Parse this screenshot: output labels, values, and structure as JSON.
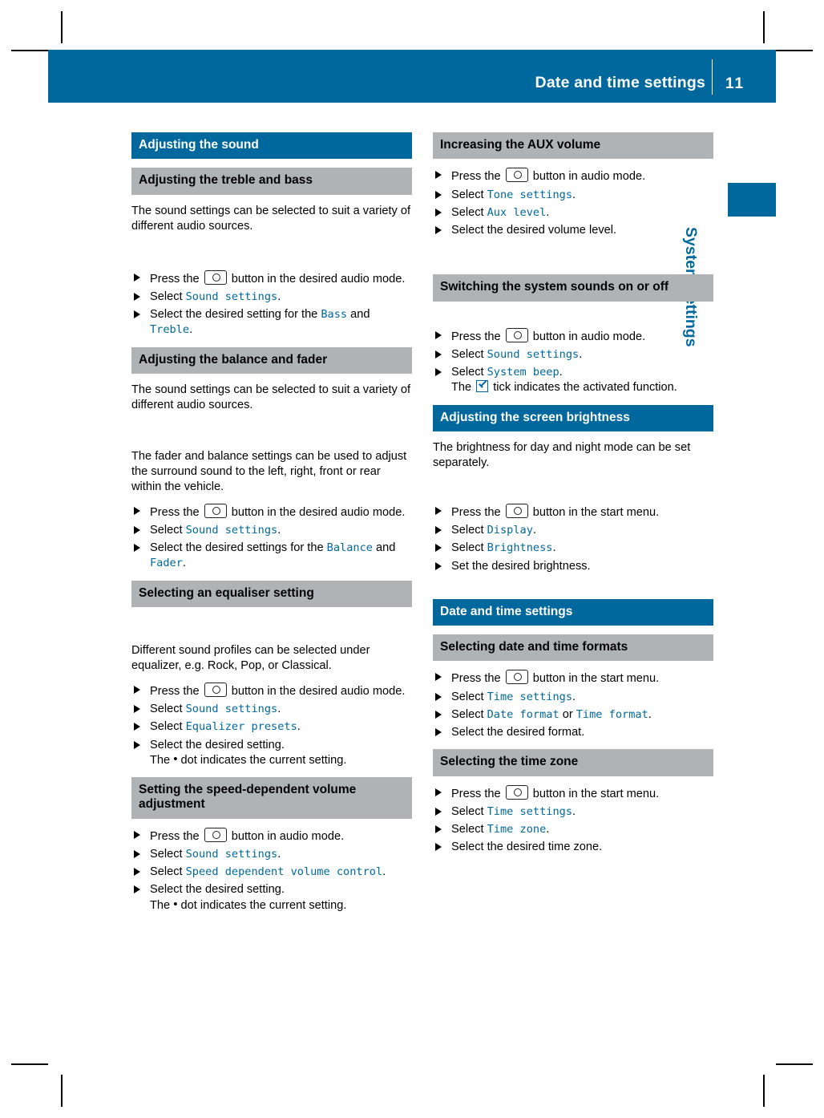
{
  "header": {
    "title": "Date and time settings",
    "page_number": "11",
    "side_tab_label": "System settings"
  },
  "icons": {
    "control_button": "control-knob-button-icon",
    "tick": "checkbox-tick-icon",
    "dot": "•"
  },
  "left_column": [
    {
      "type": "bar_blue",
      "name": "section-adjusting-the-sound",
      "text": "Adjusting the sound"
    },
    {
      "type": "bar_gray",
      "name": "subsection-adjusting-the-treble-and-bass",
      "text": "Adjusting the treble and bass"
    },
    {
      "type": "paragraph",
      "name": "paragraph-sound-settings-sources",
      "text": "The sound settings can be selected to suit a variety of different audio sources."
    },
    {
      "type": "steps",
      "name": "steps-treble-bass",
      "items": [
        {
          "parts": [
            {
              "t": "Press the "
            },
            {
              "icon": "control_button"
            },
            {
              "t": " button in the desired audio mode."
            }
          ]
        },
        {
          "parts": [
            {
              "t": "Select "
            },
            {
              "m": "Sound settings"
            },
            {
              "t": "."
            }
          ]
        },
        {
          "parts": [
            {
              "t": "Select the desired setting for the "
            },
            {
              "m": "Bass"
            },
            {
              "t": " and "
            },
            {
              "m": "Treble"
            },
            {
              "t": "."
            }
          ]
        }
      ]
    },
    {
      "type": "bar_gray",
      "name": "subsection-adjusting-the-balance-and-fader",
      "text": "Adjusting the balance and fader"
    },
    {
      "type": "paragraph",
      "name": "paragraph-sound-settings-sources-2",
      "text": "The sound settings can be selected to suit a variety of different audio sources."
    },
    {
      "type": "paragraph",
      "name": "paragraph-fader-balance",
      "text": "The fader and balance settings can be used to adjust the surround sound to the left, right, front or rear within the vehicle."
    },
    {
      "type": "steps",
      "name": "steps-balance-fader",
      "items": [
        {
          "parts": [
            {
              "t": "Press the "
            },
            {
              "icon": "control_button"
            },
            {
              "t": " button in the desired audio mode."
            }
          ]
        },
        {
          "parts": [
            {
              "t": "Select "
            },
            {
              "m": "Sound settings"
            },
            {
              "t": "."
            }
          ]
        },
        {
          "parts": [
            {
              "t": "Select the desired settings for the "
            },
            {
              "m": "Balance"
            },
            {
              "t": " and "
            },
            {
              "m": "Fader"
            },
            {
              "t": "."
            }
          ]
        }
      ]
    },
    {
      "type": "bar_gray",
      "name": "subsection-selecting-an-equaliser-setting",
      "text": "Selecting an equaliser setting"
    },
    {
      "type": "paragraph",
      "name": "paragraph-sound-profiles",
      "text": "Different sound profiles can be selected under equalizer, e.g. Rock, Pop, or Classical."
    },
    {
      "type": "steps",
      "name": "steps-equaliser",
      "items": [
        {
          "parts": [
            {
              "t": "Press the "
            },
            {
              "icon": "control_button"
            },
            {
              "t": " button in the desired audio mode."
            }
          ]
        },
        {
          "parts": [
            {
              "t": "Select "
            },
            {
              "m": "Sound settings"
            },
            {
              "t": "."
            }
          ]
        },
        {
          "parts": [
            {
              "t": "Select "
            },
            {
              "m": "Equalizer presets"
            },
            {
              "t": "."
            }
          ]
        },
        {
          "parts": [
            {
              "t": "Select the desired setting."
            },
            {
              "br": true
            },
            {
              "t": "The "
            },
            {
              "icon": "dot"
            },
            {
              "t": " dot indicates the current setting."
            }
          ]
        }
      ]
    },
    {
      "type": "bar_gray",
      "name": "subsection-setting-speed-dependent-volume",
      "text": "Setting the speed-dependent volume adjustment"
    },
    {
      "type": "steps",
      "name": "steps-speed-dependent-volume",
      "items": [
        {
          "parts": [
            {
              "t": "Press the "
            },
            {
              "icon": "control_button"
            },
            {
              "t": " button in audio mode."
            }
          ]
        },
        {
          "parts": [
            {
              "t": "Select "
            },
            {
              "m": "Sound settings"
            },
            {
              "t": "."
            }
          ]
        },
        {
          "parts": [
            {
              "t": "Select "
            },
            {
              "m": "Speed dependent volume control"
            },
            {
              "t": "."
            }
          ]
        },
        {
          "parts": [
            {
              "t": "Select the desired setting."
            },
            {
              "br": true
            },
            {
              "t": "The "
            },
            {
              "icon": "dot"
            },
            {
              "t": " dot indicates the current setting."
            }
          ]
        }
      ]
    }
  ],
  "right_column": [
    {
      "type": "bar_gray",
      "name": "subsection-increasing-the-aux-volume",
      "text": "Increasing the AUX volume"
    },
    {
      "type": "steps",
      "name": "steps-aux-volume",
      "items": [
        {
          "parts": [
            {
              "t": "Press the "
            },
            {
              "icon": "control_button"
            },
            {
              "t": " button in audio mode."
            }
          ]
        },
        {
          "parts": [
            {
              "t": "Select "
            },
            {
              "m": "Tone settings"
            },
            {
              "t": "."
            }
          ]
        },
        {
          "parts": [
            {
              "t": "Select "
            },
            {
              "m": "Aux level"
            },
            {
              "t": "."
            }
          ]
        },
        {
          "parts": [
            {
              "t": "Select the desired volume level."
            }
          ]
        }
      ]
    },
    {
      "type": "bar_gray",
      "name": "subsection-switching-system-sounds",
      "text": "Switching the system sounds on or off"
    },
    {
      "type": "steps",
      "name": "steps-system-sounds",
      "items": [
        {
          "parts": [
            {
              "t": "Press the "
            },
            {
              "icon": "control_button"
            },
            {
              "t": " button in audio mode."
            }
          ]
        },
        {
          "parts": [
            {
              "t": "Select "
            },
            {
              "m": "Sound settings"
            },
            {
              "t": "."
            }
          ]
        },
        {
          "parts": [
            {
              "t": "Select "
            },
            {
              "m": "System beep"
            },
            {
              "t": "."
            },
            {
              "br": true
            },
            {
              "t": "The "
            },
            {
              "icon": "tick"
            },
            {
              "t": " tick indicates the activated function."
            }
          ]
        }
      ]
    },
    {
      "type": "bar_blue",
      "name": "section-adjusting-the-screen-brightness",
      "text": "Adjusting the screen brightness"
    },
    {
      "type": "paragraph",
      "name": "paragraph-brightness",
      "text": "The brightness for day and night mode can be set separately."
    },
    {
      "type": "steps",
      "name": "steps-brightness",
      "items": [
        {
          "parts": [
            {
              "t": "Press the "
            },
            {
              "icon": "control_button"
            },
            {
              "t": " button in the start menu."
            }
          ]
        },
        {
          "parts": [
            {
              "t": "Select "
            },
            {
              "m": "Display"
            },
            {
              "t": "."
            }
          ]
        },
        {
          "parts": [
            {
              "t": "Select "
            },
            {
              "m": "Brightness"
            },
            {
              "t": "."
            }
          ]
        },
        {
          "parts": [
            {
              "t": "Set the desired brightness."
            }
          ]
        }
      ]
    },
    {
      "type": "bar_blue",
      "name": "section-date-and-time-settings",
      "text": "Date and time settings"
    },
    {
      "type": "bar_gray",
      "name": "subsection-selecting-date-and-time-formats",
      "text": "Selecting date and time formats"
    },
    {
      "type": "steps",
      "name": "steps-date-time-formats",
      "items": [
        {
          "parts": [
            {
              "t": "Press the "
            },
            {
              "icon": "control_button"
            },
            {
              "t": " button in the start menu."
            }
          ]
        },
        {
          "parts": [
            {
              "t": "Select "
            },
            {
              "m": "Time settings"
            },
            {
              "t": "."
            }
          ]
        },
        {
          "parts": [
            {
              "t": "Select "
            },
            {
              "m": "Date format"
            },
            {
              "t": " or "
            },
            {
              "m": "Time format"
            },
            {
              "t": "."
            }
          ]
        },
        {
          "parts": [
            {
              "t": "Select the desired format."
            }
          ]
        }
      ]
    },
    {
      "type": "bar_gray",
      "name": "subsection-selecting-the-time-zone",
      "text": "Selecting the time zone"
    },
    {
      "type": "steps",
      "name": "steps-time-zone",
      "items": [
        {
          "parts": [
            {
              "t": "Press the "
            },
            {
              "icon": "control_button"
            },
            {
              "t": " button in the start menu."
            }
          ]
        },
        {
          "parts": [
            {
              "t": "Select "
            },
            {
              "m": "Time settings"
            },
            {
              "t": "."
            }
          ]
        },
        {
          "parts": [
            {
              "t": "Select "
            },
            {
              "m": "Time zone"
            },
            {
              "t": "."
            }
          ]
        },
        {
          "parts": [
            {
              "t": "Select the desired time zone."
            }
          ]
        }
      ]
    }
  ],
  "spacers": {
    "left": {
      "2": "",
      "5": ""
    },
    "right": {}
  }
}
